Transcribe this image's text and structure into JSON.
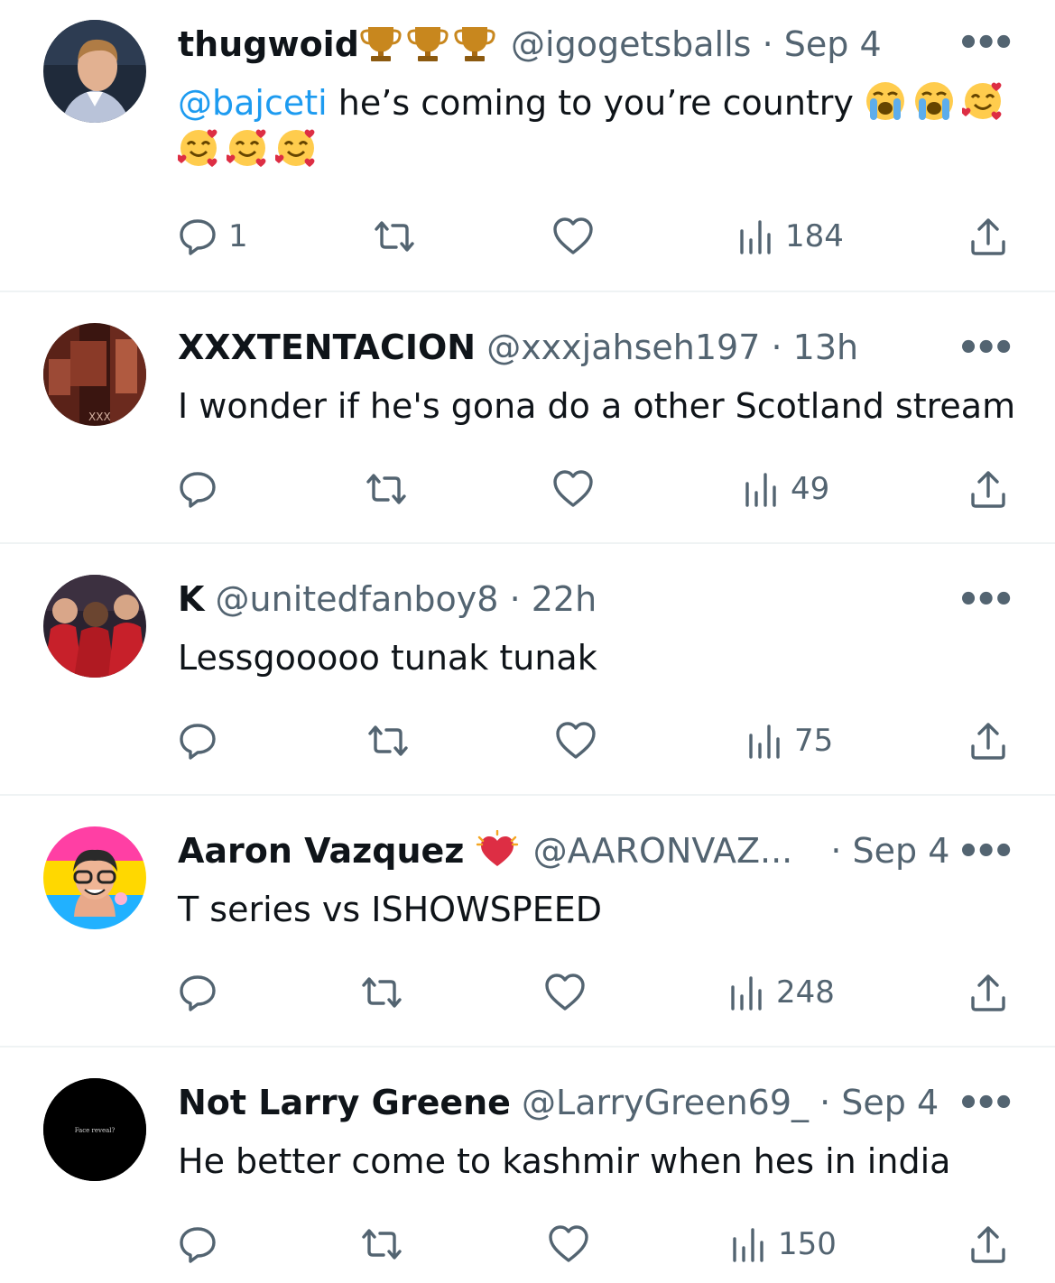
{
  "colors": {
    "link": "#1d9bf0",
    "secondary": "#536471",
    "divider": "#eff3f4"
  },
  "tweets": [
    {
      "name": "thugwoid",
      "handle": "@igogetsballs",
      "separator": "·",
      "time": "Sep 4",
      "mention": "@bajceti",
      "text": "he’s coming to you’re country",
      "name_badges": [
        "trophy-icon",
        "trophy-icon",
        "trophy-icon"
      ],
      "emojis": [
        "loudly-crying-face",
        "loudly-crying-face",
        "smiling-face-with-hearts",
        "smiling-face-with-hearts",
        "smiling-face-with-hearts",
        "smiling-face-with-hearts"
      ],
      "replies": "1",
      "views": "184"
    },
    {
      "name": "XXXTENTACION",
      "handle": "@xxxjahseh197",
      "separator": "·",
      "time": "13h",
      "text": "I wonder if he's gona do a other Scotland stream",
      "views": "49"
    },
    {
      "name": "K",
      "handle": "@unitedfanboy8",
      "separator": "·",
      "time": "22h",
      "text": "Lessgooooo tunak tunak",
      "views": "75"
    },
    {
      "name": "Aaron Vazquez",
      "name_badges": [
        "beating-heart-icon"
      ],
      "handle": "@AARONVAZ...",
      "separator": "·",
      "time": "Sep 4",
      "text": "T series vs ISHOWSPEED",
      "views": "248"
    },
    {
      "name": "Not Larry Greene",
      "handle": "@LarryGreen69_",
      "separator": "·",
      "time": "Sep 4",
      "text": "He better come to kashmir when hes in india",
      "avatar_text": "Face reveal?",
      "views": "150"
    }
  ]
}
